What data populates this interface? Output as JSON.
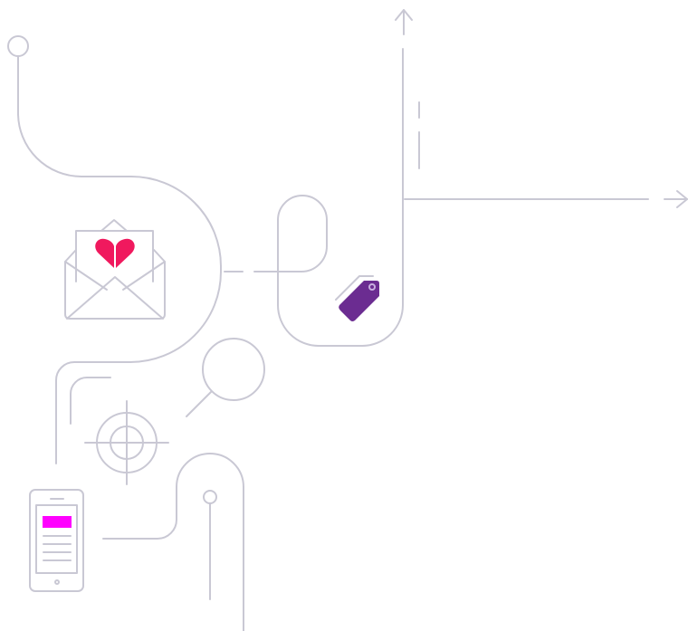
{
  "colors": {
    "background": "#ffffff",
    "line": "#c9c8d4",
    "heart": "#f0195e",
    "tag": "#6b2c91",
    "tag_hole": "#c8aee0",
    "phone_highlight": "#ff00ff"
  },
  "icons": [
    "envelope-icon",
    "heart-icon",
    "price-tag-icon",
    "magnifier-icon",
    "target-crosshair-icon",
    "smartphone-icon",
    "arrow-up-icon",
    "arrow-right-icon"
  ]
}
